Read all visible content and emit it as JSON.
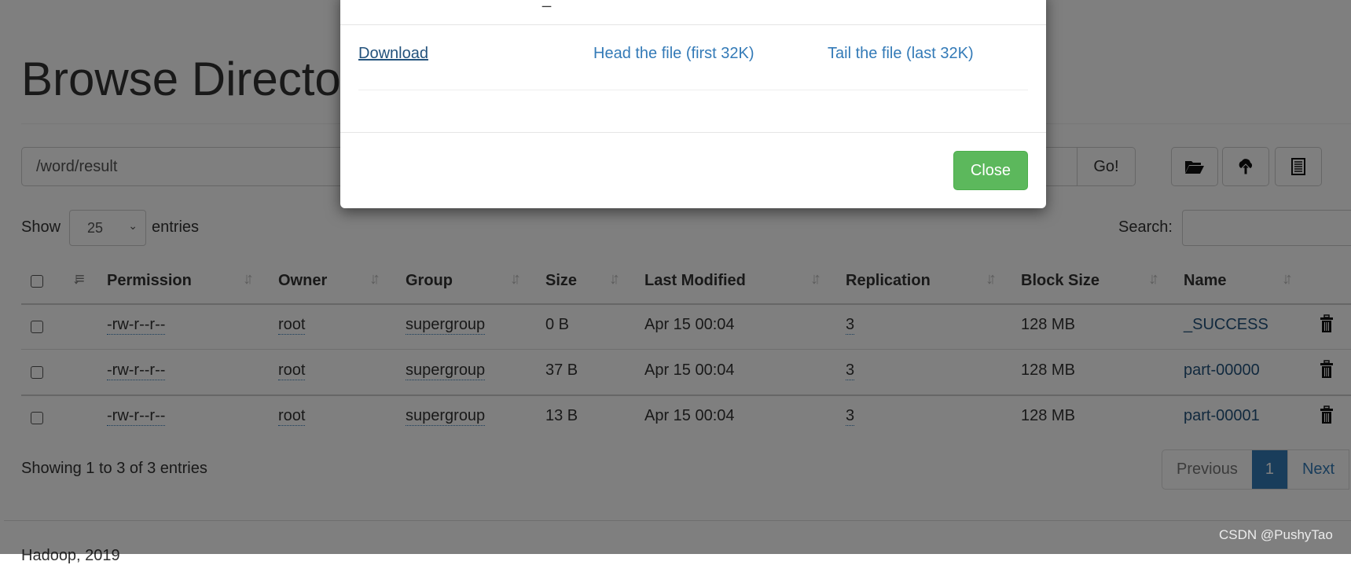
{
  "page": {
    "title": "Browse Directory",
    "footer": "Hadoop, 2019"
  },
  "path_bar": {
    "value": "/word/result",
    "go_label": "Go!",
    "icons": [
      "folder-open-icon",
      "cloud-upload-icon",
      "list-icon"
    ]
  },
  "table_controls": {
    "show_label": "Show",
    "entries_value": "25",
    "entries_label": "entries",
    "search_label": "Search:"
  },
  "table": {
    "headers": [
      "Permission",
      "Owner",
      "Group",
      "Size",
      "Last Modified",
      "Replication",
      "Block Size",
      "Name"
    ],
    "rows": [
      {
        "permission": "-rw-r--r--",
        "owner": "root",
        "group": "supergroup",
        "size": "0 B",
        "modified": "Apr 15 00:04",
        "replication": "3",
        "block_size": "128 MB",
        "name": "_SUCCESS"
      },
      {
        "permission": "-rw-r--r--",
        "owner": "root",
        "group": "supergroup",
        "size": "37 B",
        "modified": "Apr 15 00:04",
        "replication": "3",
        "block_size": "128 MB",
        "name": "part-00000"
      },
      {
        "permission": "-rw-r--r--",
        "owner": "root",
        "group": "supergroup",
        "size": "13 B",
        "modified": "Apr 15 00:04",
        "replication": "3",
        "block_size": "128 MB",
        "name": "part-00001"
      }
    ]
  },
  "info": {
    "showing": "Showing 1 to 3 of 3 entries"
  },
  "pagination": {
    "previous": "Previous",
    "current": "1",
    "next": "Next"
  },
  "modal": {
    "title_fragment": "_",
    "download": "Download",
    "head": "Head the file (first 32K)",
    "tail": "Tail the file (last 32K)",
    "close": "Close"
  },
  "colors": {
    "link": "#337ab7",
    "success_button": "#5cb85c",
    "active_page": "#337ab7",
    "overlay": "rgba(0,0,0,0.5)"
  },
  "watermark": "CSDN @PushyTao"
}
